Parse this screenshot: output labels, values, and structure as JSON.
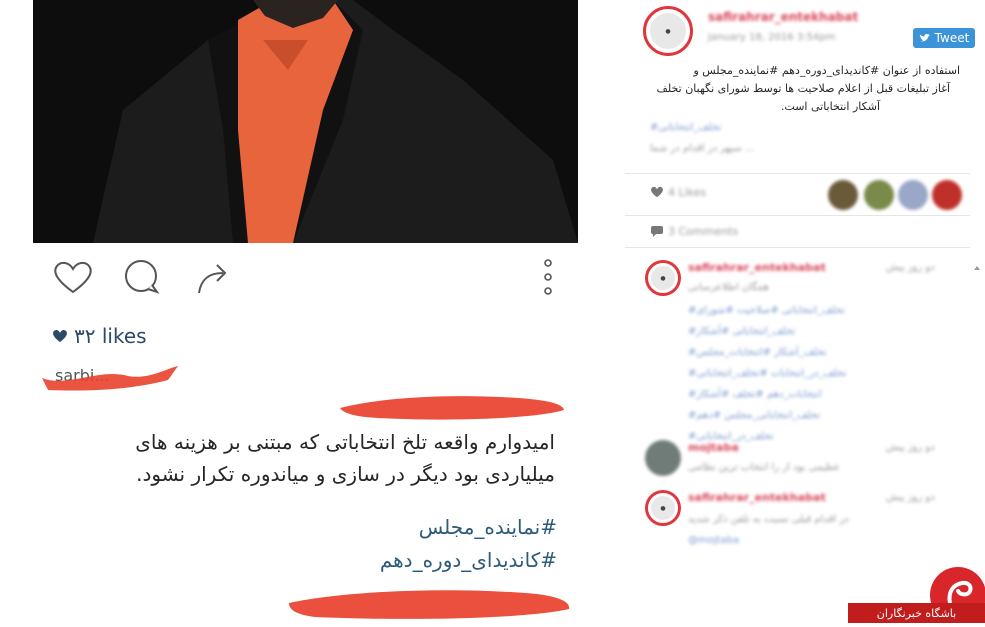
{
  "post": {
    "likes_count": "۳۲ likes",
    "author_handle": "sarbi...",
    "caption_lines": [
      "امیدوارم واقعه تلخ انتخاباتی که مبتنی بر هزینه های",
      "میلیاردی بود دیگر در سازی و میاندوره تکرار نشود."
    ],
    "hashtags": [
      "#نماینده_مجلس",
      "#کاندیدای_دوره_دهم"
    ]
  },
  "embed": {
    "account": "safirahrar_entekhabat",
    "date": "January 18, 2016 3:54pm",
    "tweet_label": "Tweet",
    "text_lines": [
      "استفاده از عنوان #کاندیدای_دوره_دهم #نماینده_مجلس و",
      "آغاز تبلیغات قبل از اعلام صلاحیت ها توسط شورای نگهبان تخلف",
      "آشکار انتخاباتی است."
    ],
    "likes_label": "4 Likes",
    "comments_label": "3 Comments"
  },
  "comments": [
    {
      "user": "safirahrar_entekhabat",
      "time": "دو روز پیش",
      "text": "همگان اطلاعرسانی"
    },
    {
      "user": "mojtaba",
      "time": "دو روز پیش",
      "text": "عظیمی بود از را انتخاب ترین نظامی"
    },
    {
      "user": "safirahrar_entekhabat",
      "time": "دو روز پیش",
      "text": "در اقدام قبلی نسبت به تلفن ذکر شدید"
    }
  ],
  "watermark": {
    "text": "باشگاه خبرنگاران"
  },
  "colors": {
    "accent": "#e0363c",
    "tweet": "#3b94d9",
    "hashtag": "#2c5b7a",
    "highlight": "#e8412c"
  }
}
